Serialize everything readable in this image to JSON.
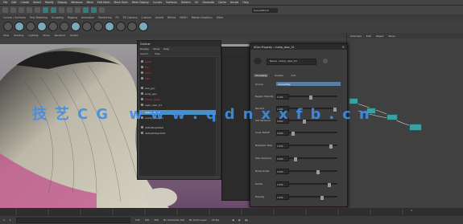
{
  "menubar": {
    "items": [
      "File",
      "Edit",
      "Create",
      "Select",
      "Modify",
      "Display",
      "Windows",
      "Mesh",
      "Edit Mesh",
      "Mesh Tools",
      "Mesh Display",
      "Curves",
      "Surfaces",
      "Deform",
      "UV",
      "Generate",
      "Cache",
      "Arnold",
      "Help"
    ]
  },
  "status": {
    "field": "CanvasHOut"
  },
  "shelf": {
    "tabs": [
      "Curves / Surfaces",
      "Poly Modeling",
      "Sculpting",
      "Rigging",
      "Animation",
      "Rendering",
      "FX",
      "FX Caching",
      "Custom",
      "Arnold",
      "Bifrost",
      "MASH",
      "Motion Graphics",
      "XGen"
    ]
  },
  "viewport": {
    "menu": [
      "View",
      "Shading",
      "Lighting",
      "Show",
      "Renderer",
      "Panels"
    ]
  },
  "outliner": {
    "title": "Outliner",
    "menu": [
      "Display",
      "Show",
      "Help"
    ],
    "submenu": [
      "Search...",
      "Help"
    ],
    "rows": [
      {
        "label": "persp",
        "color": "red"
      },
      {
        "label": "top",
        "color": "red"
      },
      {
        "label": "front",
        "color": "red"
      },
      {
        "label": "side",
        "color": "red"
      },
      {
        "label": "hair_grp",
        "color": "grey"
      },
      {
        "label": "body_geo",
        "color": "grey"
      },
      {
        "label": "clump_guide",
        "color": "red"
      },
      {
        "label": "xgen_desc_01",
        "color": "grey"
      },
      {
        "label": "description1",
        "color": "grey"
      },
      {
        "label": "clump_desc_01",
        "color": "grey"
      },
      {
        "label": "defaultLightSet",
        "color": "grey"
      },
      {
        "label": "defaultObjectSet",
        "color": "grey"
      }
    ],
    "selected": "description1"
  },
  "prop": {
    "title": "XGen Property : clump_desc_01",
    "name_label": "Name",
    "name_value": "clump_desc_01",
    "tabs": [
      "Clumping",
      "Guides",
      "Cut"
    ],
    "active_tab": "Clumping",
    "rows": [
      {
        "label": "Clump",
        "value": "clumpMap"
      },
      {
        "label": "Region Density",
        "value": "0.100",
        "knob": 0.45
      },
      {
        "label": "Percent",
        "value": "1.000",
        "knob": 0.98
      },
      {
        "label": "Set Variance",
        "value": "0.060",
        "knob": 0.3
      },
      {
        "label": "Inner Falloff",
        "value": "0.000",
        "knob": 0.05
      },
      {
        "label": "Neighbor Size",
        "value": "1.000",
        "knob": 0.9
      },
      {
        "label": "Size Variance",
        "value": "0.000",
        "knob": 0.1
      },
      {
        "label": "Noise Scale",
        "value": "0.500",
        "knob": 0.6
      },
      {
        "label": "Guide",
        "value": "1.000",
        "knob": 0.85
      },
      {
        "label": "Density",
        "value": "1.000",
        "knob": 0.7
      }
    ]
  },
  "rightpanel": {
    "tabs": [
      "Channels",
      "Edit",
      "Object",
      "Show"
    ]
  },
  "timeline": {
    "start": "1",
    "end": "120",
    "current": "1"
  },
  "rangebar": {
    "items": [
      "1",
      "1",
      "120",
      "120",
      "200",
      "No Character Set",
      "No Anim Layer",
      "24 fps"
    ]
  },
  "watermark": "技艺CG www.qdnxxfb.cn"
}
